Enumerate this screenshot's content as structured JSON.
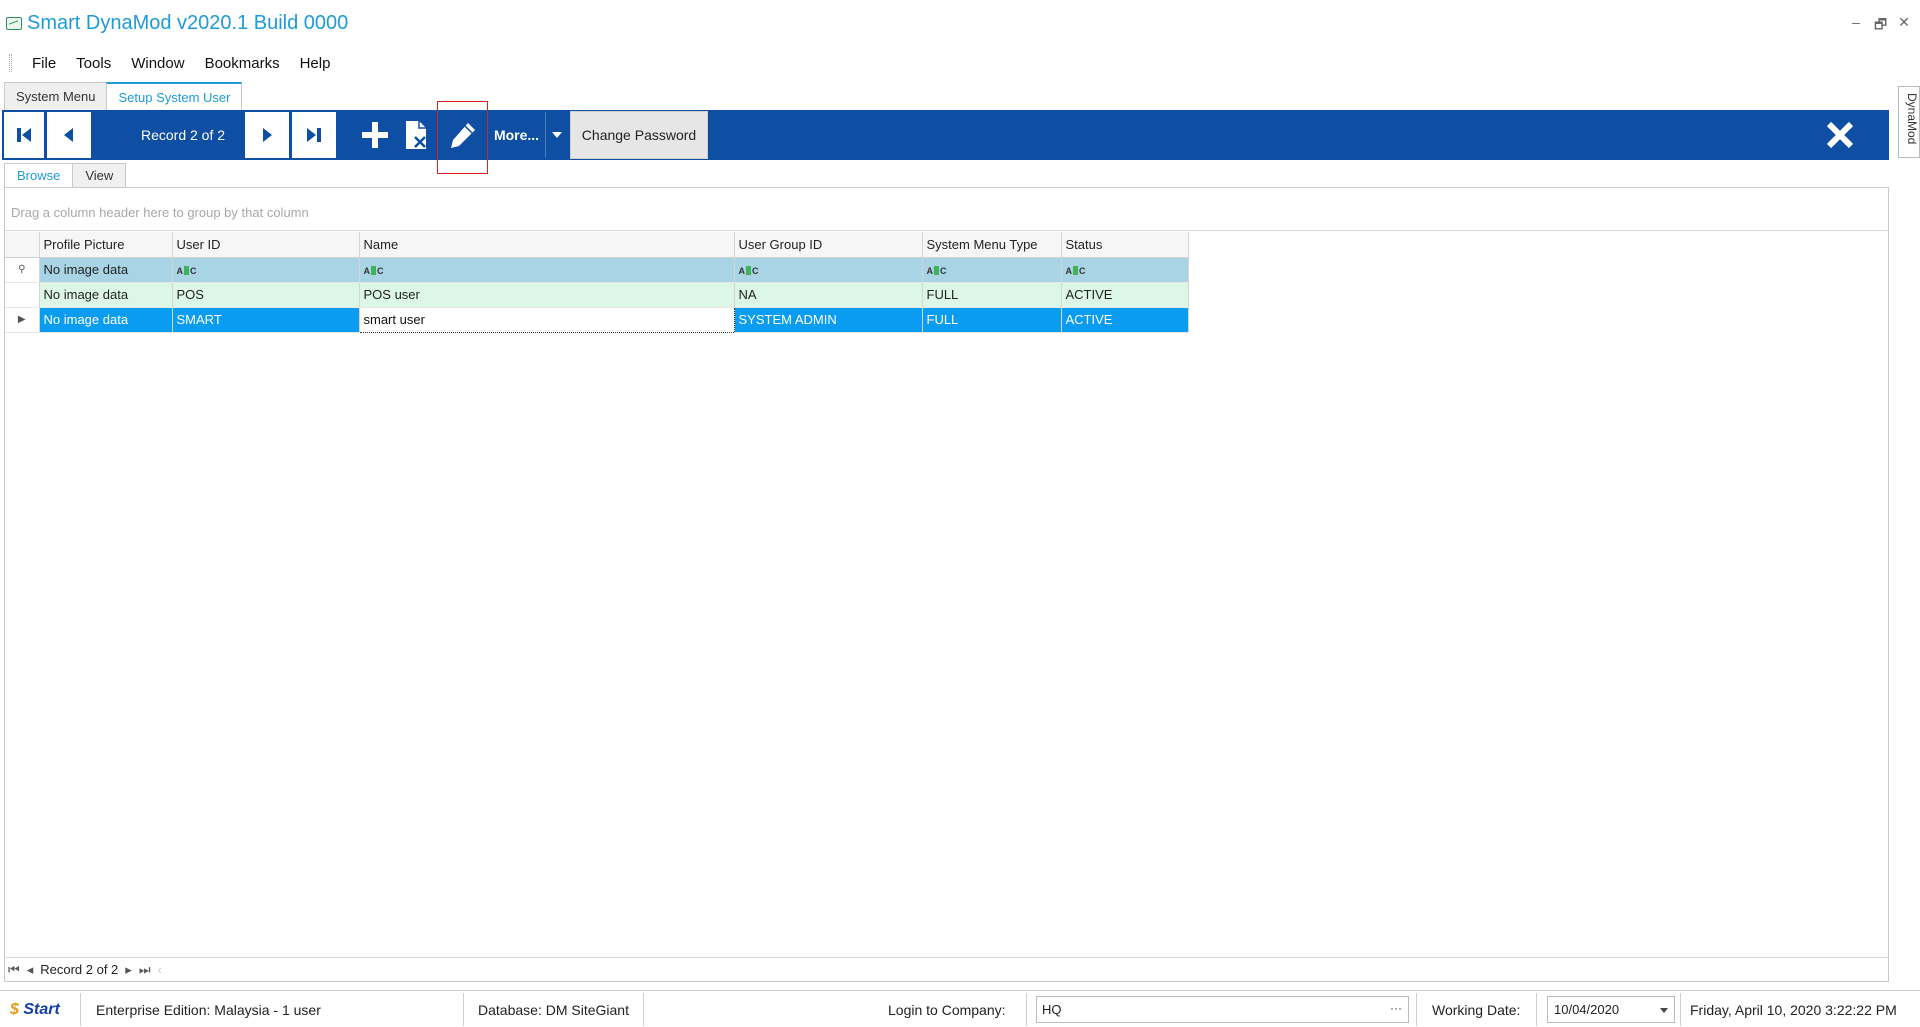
{
  "window": {
    "title": "Smart DynaMod v2020.1 Build 0000",
    "controls": {
      "minimize": "–",
      "restore": "🗗",
      "close": "✕"
    }
  },
  "menu": {
    "items": [
      "File",
      "Tools",
      "Window",
      "Bookmarks",
      "Help"
    ]
  },
  "doc_tabs": [
    {
      "label": "System Menu",
      "active": false
    },
    {
      "label": "Setup System User",
      "active": true
    }
  ],
  "side_tab": {
    "label": "DynaMod"
  },
  "toolbar": {
    "record_label": "Record 2 of 2",
    "more_label": "More...",
    "change_password_label": "Change Password",
    "accent_color": "#0e4fa3",
    "icons": [
      "first-record-icon",
      "previous-record-icon",
      "next-record-icon",
      "last-record-icon",
      "add-icon",
      "delete-icon",
      "edit-pencil-icon",
      "close-x-icon"
    ]
  },
  "view_tabs": [
    {
      "label": "Browse",
      "active": true
    },
    {
      "label": "View",
      "active": false
    }
  ],
  "grid": {
    "group_panel_hint": "Drag a column header here to group by that column",
    "columns": [
      "Profile Picture",
      "User ID",
      "Name",
      "User Group ID",
      "System Menu Type",
      "Status"
    ],
    "filter_row": {
      "profile_picture": "No image data"
    },
    "rows": [
      {
        "profile_picture": "No image data",
        "user_id": "POS",
        "name": "POS user",
        "user_group_id": "NA",
        "system_menu_type": "FULL",
        "status": "ACTIVE"
      },
      {
        "profile_picture": "No image data",
        "user_id": "SMART",
        "name": "smart user",
        "user_group_id": "SYSTEM ADMIN",
        "system_menu_type": "FULL",
        "status": "ACTIVE"
      }
    ],
    "selected_row_color": "#0a9cf0",
    "alt_row_color": "#ddf7e6",
    "filter_row_color": "#a8d4e6"
  },
  "grid_nav": {
    "record_label": "Record 2 of 2"
  },
  "status_bar": {
    "logo_text": "Start",
    "edition": "Enterprise Edition: Malaysia - 1 user",
    "database": "Database: DM SiteGiant",
    "login_label": "Login to Company:",
    "login_value": "HQ",
    "working_date_label": "Working Date:",
    "working_date_value": "10/04/2020",
    "datetime": "Friday, April 10, 2020 3:22:22 PM"
  }
}
